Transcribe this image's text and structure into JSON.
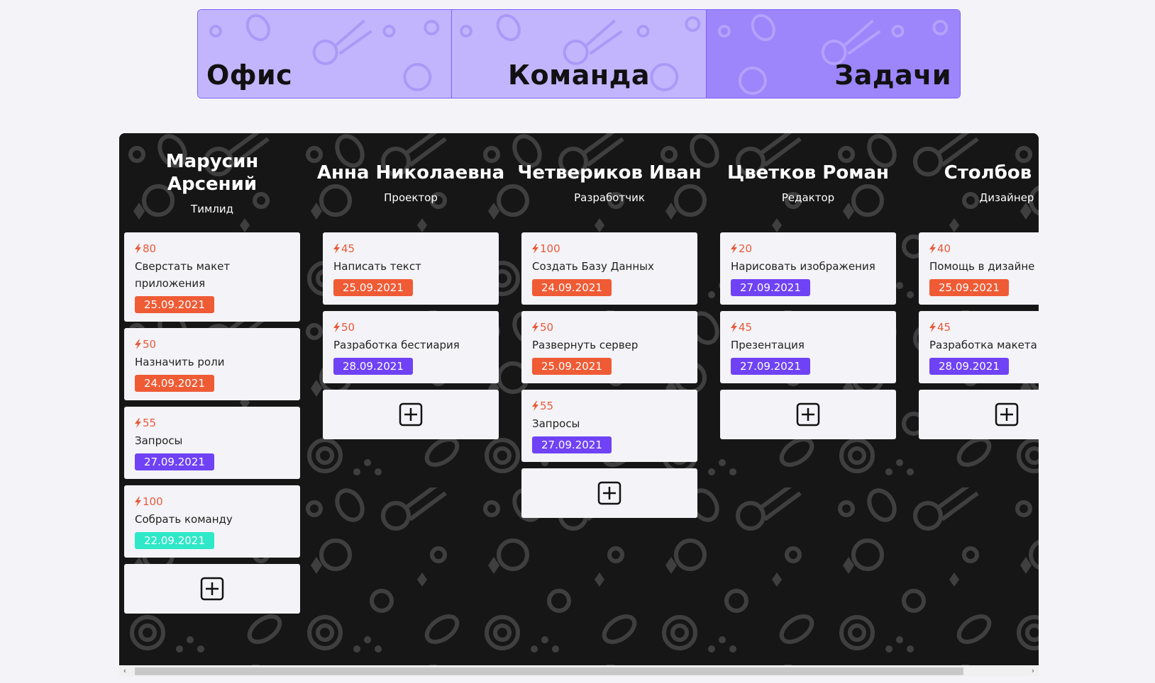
{
  "tabs": [
    {
      "label": "Офис",
      "active": false
    },
    {
      "label": "Команда",
      "active": false
    },
    {
      "label": "Задачи",
      "active": true
    }
  ],
  "colors": {
    "tab_bg": "#c3b5fd",
    "tab_active_bg": "#9d85fb",
    "board_bg": "#161616",
    "date_overdue": "#ef5b35",
    "date_upcoming": "#6f42f5",
    "date_done": "#2ee8c8",
    "points": "#e85a3a"
  },
  "columns": [
    {
      "name": "Марусин Арсений",
      "role": "Тимлид",
      "tasks": [
        {
          "points": "80",
          "title": "Сверстать макет приложения",
          "date": "25.09.2021",
          "status": "overdue"
        },
        {
          "points": "50",
          "title": "Назначить роли",
          "date": "24.09.2021",
          "status": "overdue"
        },
        {
          "points": "55",
          "title": "Запросы",
          "date": "27.09.2021",
          "status": "upcoming"
        },
        {
          "points": "100",
          "title": "Собрать команду",
          "date": "22.09.2021",
          "status": "done"
        }
      ]
    },
    {
      "name": "Анна Николаевна",
      "role": "Проектор",
      "tasks": [
        {
          "points": "45",
          "title": "Написать текст",
          "date": "25.09.2021",
          "status": "overdue"
        },
        {
          "points": "50",
          "title": "Разработка бестиария",
          "date": "28.09.2021",
          "status": "upcoming"
        }
      ]
    },
    {
      "name": "Четвериков Иван",
      "role": "Разработчик",
      "tasks": [
        {
          "points": "100",
          "title": "Создать Базу Данных",
          "date": "24.09.2021",
          "status": "overdue"
        },
        {
          "points": "50",
          "title": "Развернуть сервер",
          "date": "25.09.2021",
          "status": "overdue"
        },
        {
          "points": "55",
          "title": "Запросы",
          "date": "27.09.2021",
          "status": "upcoming"
        }
      ]
    },
    {
      "name": "Цветков Роман",
      "role": "Редактор",
      "tasks": [
        {
          "points": "20",
          "title": "Нарисовать изображения",
          "date": "27.09.2021",
          "status": "upcoming"
        },
        {
          "points": "45",
          "title": "Презентация",
          "date": "27.09.2021",
          "status": "upcoming"
        }
      ]
    },
    {
      "name": "Столбов Ми",
      "role": "Дизайнер",
      "tasks": [
        {
          "points": "40",
          "title": "Помощь в дизайне",
          "date": "25.09.2021",
          "status": "overdue"
        },
        {
          "points": "45",
          "title": "Разработка макета",
          "date": "28.09.2021",
          "status": "upcoming"
        }
      ]
    }
  ],
  "icons": {
    "points": "lightning-icon",
    "add": "plus-square-icon",
    "scroll_left": "chevron-left-icon",
    "scroll_right": "chevron-right-icon"
  }
}
